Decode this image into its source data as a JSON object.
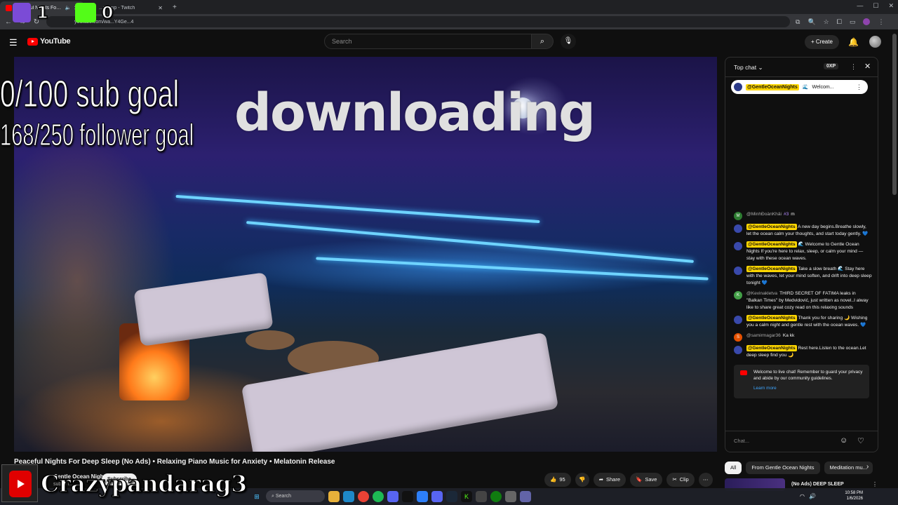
{
  "browser": {
    "tabs": [
      {
        "title": "Peaceful Nights For Deep Sl",
        "active": true
      },
      {
        "title": "...rkemp - Twitch",
        "active": false
      }
    ],
    "url": "youtube.com/wa...Y4Ge...4"
  },
  "overlay": {
    "twitch_count": "1",
    "kick_count": "0",
    "sub_goal": "0/100 sub goal",
    "follower_goal": "168/250 follower goal",
    "status_text": "downloading",
    "streamer_name": "Crazypandarag3"
  },
  "youtube": {
    "logo_text": "YouTube",
    "search_placeholder": "Search",
    "create_label": "Create"
  },
  "video": {
    "title": "Peaceful Nights For Deep Sleep (No Ads) • Relaxing Piano Music for Anxiety • Melatonin Release",
    "channel_name": "Gentle Ocean Nights",
    "channel_subs": "subscri...",
    "subscribe_label": "Subscribe",
    "likes": "95",
    "share_label": "Share",
    "save_label": "Save",
    "clip_label": "Clip"
  },
  "chat": {
    "header_title": "Top chat",
    "xp_label": "0XP",
    "pinned": {
      "author": "@GentleOceanNights",
      "text": "Welcom..."
    },
    "messages": [
      {
        "author": "@MinhĐoànKhải",
        "badge": "#3",
        "text": "m",
        "avatar_letter": "M",
        "avatar_color": "#2e7d32",
        "mention": false
      },
      {
        "author": "@GentleOceanNights",
        "text": "A new day begins.Breathe slowly, let the ocean calm your thoughts, and start today gently. 💙",
        "avatar_letter": "",
        "avatar_color": "#3949ab",
        "mention": true
      },
      {
        "author": "@GentleOceanNights",
        "text": "🌊 Welcome to Gentle Ocean Nights If you're here to relax, sleep, or calm your mind — stay with these ocean waves.",
        "avatar_letter": "",
        "avatar_color": "#3949ab",
        "mention": true
      },
      {
        "author": "@GentleOceanNights",
        "text": "Take a slow breath 🌊 Stay here with the waves, let your mind soften, and drift into deep sleep tonight 💙",
        "avatar_letter": "",
        "avatar_color": "#3949ab",
        "mention": true
      },
      {
        "author": "@Kevinakletva",
        "text": "THIRD SECRET OF FATIMA leaks in \"Balkan Times\" by Medvidović, just written as novel..I alway like to share great cozy read on this relaxing sounds",
        "avatar_letter": "K",
        "avatar_color": "#43a047",
        "mention": false
      },
      {
        "author": "@GentleOceanNights",
        "text": "Thank you for sharing 🌙 Wishing you a calm night and gentle rest with the ocean waves. 💙",
        "avatar_letter": "",
        "avatar_color": "#3949ab",
        "mention": true
      },
      {
        "author": "@samirmagar36",
        "text": "Ka kk",
        "avatar_letter": "S",
        "avatar_color": "#e65100",
        "mention": false
      },
      {
        "author": "@GentleOceanNights",
        "text": "Rest here.Listen to the ocean.Let deep sleep find you 🌙",
        "avatar_letter": "",
        "avatar_color": "#3949ab",
        "mention": true
      }
    ],
    "welcome_text": "Welcome to live chat! Remember to guard your privacy and abide by our community guidelines.",
    "learn_more": "Learn more",
    "input_placeholder": "Chat..."
  },
  "related": {
    "chips": [
      "All",
      "From Gentle Ocean Nights",
      "Meditation mu..."
    ],
    "first_item_title": "(No Ads) DEEP SLEEP"
  },
  "taskbar": {
    "search_label": "Search",
    "time": "10:58 PM",
    "date": "1/6/2026"
  }
}
